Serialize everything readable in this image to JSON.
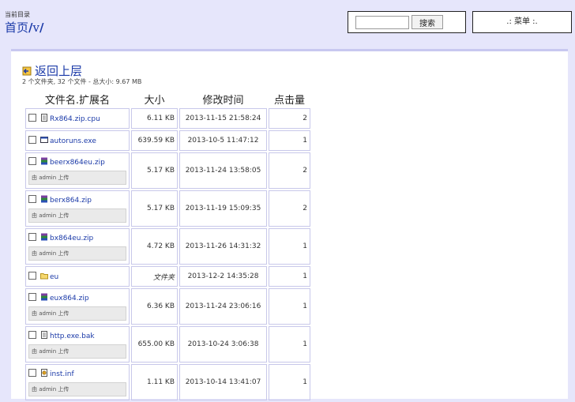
{
  "header": {
    "current_dir_label": "当前目录",
    "breadcrumb_home": "首页",
    "breadcrumb_dir": "v",
    "search_value": "",
    "search_button": "搜索",
    "menu_label": ".: 菜单 :."
  },
  "listing": {
    "back_label": "返回上层",
    "summary": "2 个文件夹, 32 个文件 - 总大小: 9.67 MB",
    "columns": [
      "文件名.扩展名",
      "大小",
      "修改时间",
      "点击量"
    ]
  },
  "files": [
    {
      "name": "Rx864.zip.cpu",
      "size": "6.11 KB",
      "time": "2013-11-15 21:58:24",
      "hits": "2",
      "icon": "text-file-icon",
      "uploader": ""
    },
    {
      "name": "autoruns.exe",
      "size": "639.59 KB",
      "time": "2013-10-5 11:47:12",
      "hits": "1",
      "icon": "exe-icon",
      "uploader": ""
    },
    {
      "name": "beerx864eu.zip",
      "size": "5.17 KB",
      "time": "2013-11-24 13:58:05",
      "hits": "2",
      "icon": "archive-icon",
      "uploader": "由 admin 上传"
    },
    {
      "name": "berx864.zip",
      "size": "5.17 KB",
      "time": "2013-11-19 15:09:35",
      "hits": "2",
      "icon": "archive-icon",
      "uploader": "由 admin 上传"
    },
    {
      "name": "bx864eu.zip",
      "size": "4.72 KB",
      "time": "2013-11-26 14:31:32",
      "hits": "1",
      "icon": "archive-icon",
      "uploader": "由 admin 上传"
    },
    {
      "name": "eu",
      "size": "文件夹",
      "time": "2013-12-2 14:35:28",
      "hits": "1",
      "icon": "folder-icon",
      "uploader": ""
    },
    {
      "name": "eux864.zip",
      "size": "6.36 KB",
      "time": "2013-11-24 23:06:16",
      "hits": "1",
      "icon": "archive-icon",
      "uploader": "由 admin 上传"
    },
    {
      "name": "http.exe.bak",
      "size": "655.00 KB",
      "time": "2013-10-24 3:06:38",
      "hits": "1",
      "icon": "text-file-icon",
      "uploader": "由 admin 上传"
    },
    {
      "name": "inst.inf",
      "size": "1.11 KB",
      "time": "2013-10-14 13:41:07",
      "hits": "1",
      "icon": "settings-file-icon",
      "uploader": "由 admin 上传"
    }
  ]
}
